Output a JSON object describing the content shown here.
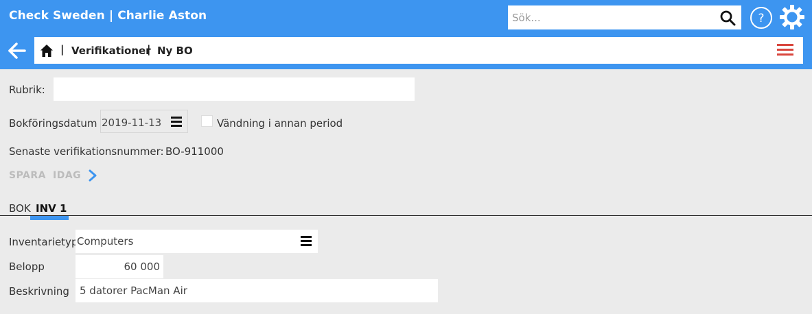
{
  "header": {
    "title": "Check Sweden | Charlie Aston",
    "search_placeholder": "Sök...",
    "icons": [
      "search-icon",
      "help-icon",
      "gear-icon"
    ],
    "accent_color": "#3d95f0"
  },
  "breadcrumb": {
    "items": [
      "Verifikationer",
      "Ny BO"
    ],
    "separator": "|"
  },
  "form": {
    "rubrik_label": "Rubrik:",
    "rubrik_value": "",
    "date_label": "Bokföringsdatum",
    "date_value": "2019-11-13",
    "reversal_label": "Vändning i annan period",
    "reversal_checked": false,
    "last_number_label": "Senaste verifikationsnummer:",
    "last_number_value": "BO-911000"
  },
  "actions": {
    "save_label": "SPARA",
    "today_label": "IDAG"
  },
  "tabs": [
    {
      "label": "BOK",
      "active": false
    },
    {
      "label": "INV 1",
      "active": true
    }
  ],
  "inventory": {
    "type_label": "Inventarietyp",
    "type_value": "Computers",
    "amount_label": "Belopp",
    "amount_value": "60 000",
    "description_label": "Beskrivning",
    "description_value": "5 datorer PacMan Air"
  },
  "colors": {
    "menu_icon": "#d9463d",
    "background": "#ebebeb"
  }
}
